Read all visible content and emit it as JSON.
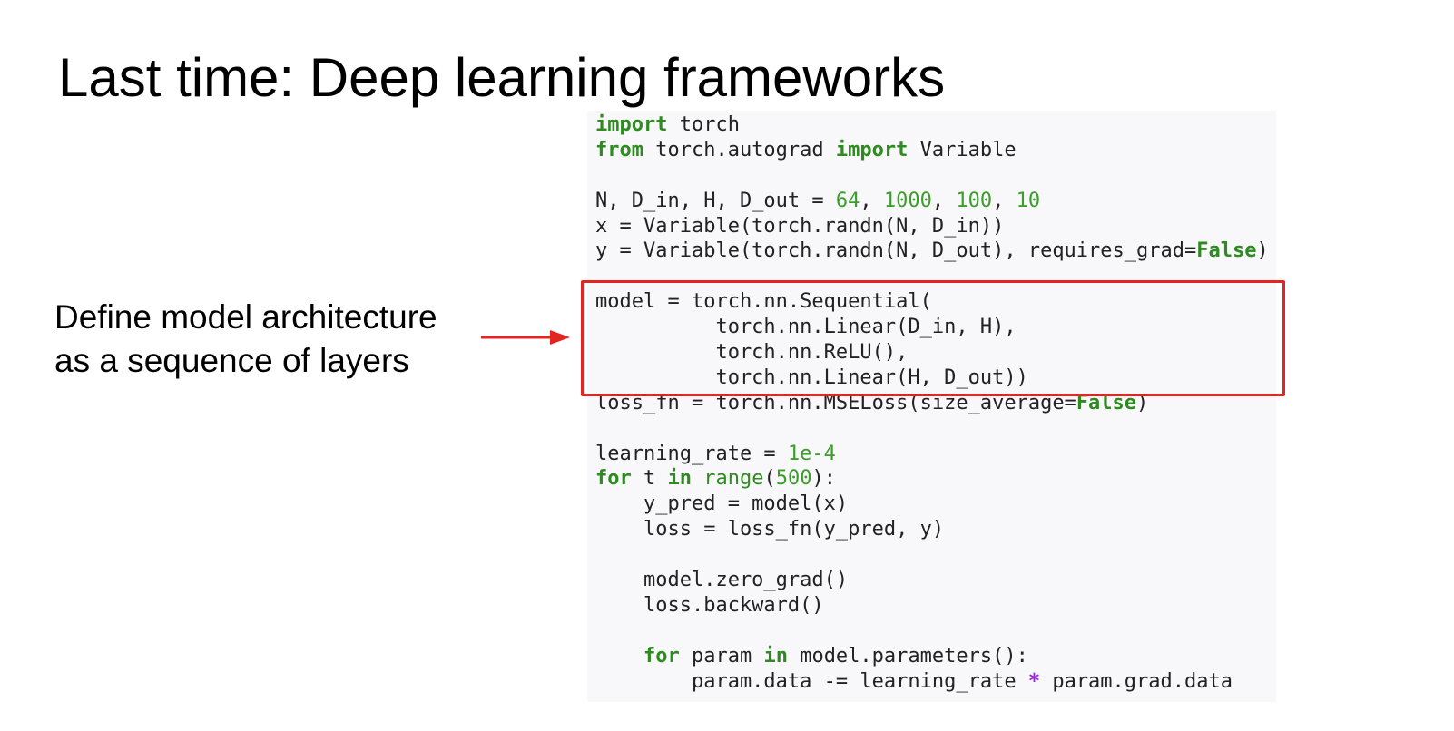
{
  "slide": {
    "title": "Last time: Deep learning frameworks",
    "annotation": {
      "line1": "Define model architecture",
      "line2": "as a sequence of layers"
    }
  },
  "colors": {
    "keyword": "#2e8b1f",
    "number": "#3a9e28",
    "operator": "#a020f0",
    "highlight_border": "#e32420",
    "arrow": "#e32420",
    "code_background": "#f8f8fa"
  },
  "icons": {
    "arrow": "right-arrow"
  },
  "code": {
    "language": "python",
    "highlighted_lines": [
      8,
      11
    ],
    "lines": [
      [
        {
          "t": "import",
          "k": "kw"
        },
        {
          "t": " torch"
        }
      ],
      [
        {
          "t": "from",
          "k": "kw"
        },
        {
          "t": " torch.autograd "
        },
        {
          "t": "import",
          "k": "kw"
        },
        {
          "t": " Variable"
        }
      ],
      [],
      [
        {
          "t": "N, D_in, H, D_out = "
        },
        {
          "t": "64",
          "k": "num"
        },
        {
          "t": ", "
        },
        {
          "t": "1000",
          "k": "num"
        },
        {
          "t": ", "
        },
        {
          "t": "100",
          "k": "num"
        },
        {
          "t": ", "
        },
        {
          "t": "10",
          "k": "num"
        }
      ],
      [
        {
          "t": "x = Variable(torch.randn(N, D_in))"
        }
      ],
      [
        {
          "t": "y = Variable(torch.randn(N, D_out), requires_grad="
        },
        {
          "t": "False",
          "k": "kw"
        },
        {
          "t": ")"
        }
      ],
      [],
      [
        {
          "t": "model = torch.nn.Sequential("
        }
      ],
      [
        {
          "t": "          torch.nn.Linear(D_in, H),"
        }
      ],
      [
        {
          "t": "          torch.nn.ReLU(),"
        }
      ],
      [
        {
          "t": "          torch.nn.Linear(H, D_out))"
        }
      ],
      [
        {
          "t": "loss_fn = torch.nn.MSELoss(size_average="
        },
        {
          "t": "False",
          "k": "kw"
        },
        {
          "t": ")"
        }
      ],
      [],
      [
        {
          "t": "learning_rate = "
        },
        {
          "t": "1e-4",
          "k": "num"
        }
      ],
      [
        {
          "t": "for",
          "k": "kw"
        },
        {
          "t": " t "
        },
        {
          "t": "in",
          "k": "kw"
        },
        {
          "t": " "
        },
        {
          "t": "range",
          "k": "bi"
        },
        {
          "t": "("
        },
        {
          "t": "500",
          "k": "num"
        },
        {
          "t": "):"
        }
      ],
      [
        {
          "t": "    y_pred = model(x)"
        }
      ],
      [
        {
          "t": "    loss = loss_fn(y_pred, y)"
        }
      ],
      [],
      [
        {
          "t": "    model.zero_grad()"
        }
      ],
      [
        {
          "t": "    loss.backward()"
        }
      ],
      [],
      [
        {
          "t": "    "
        },
        {
          "t": "for",
          "k": "kw"
        },
        {
          "t": " param "
        },
        {
          "t": "in",
          "k": "kw"
        },
        {
          "t": " model.parameters():"
        }
      ],
      [
        {
          "t": "        param.data -= learning_rate "
        },
        {
          "t": "*",
          "k": "op"
        },
        {
          "t": " param.grad.data"
        }
      ]
    ]
  }
}
